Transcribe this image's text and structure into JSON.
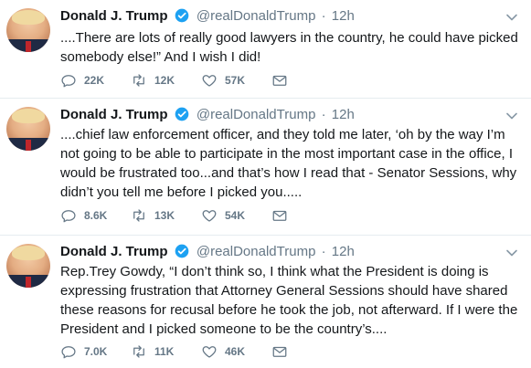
{
  "tweets": [
    {
      "name": "Donald J. Trump",
      "handle": "@realDonaldTrump",
      "separator": "·",
      "time": "12h",
      "text": "....There are lots of really good lawyers in the country, he could have picked somebody else!” And I wish I did!",
      "replies": "22K",
      "retweets": "12K",
      "likes": "57K"
    },
    {
      "name": "Donald J. Trump",
      "handle": "@realDonaldTrump",
      "separator": "·",
      "time": "12h",
      "text": "....chief law enforcement officer, and they told me later, ‘oh by the way I’m not going to be able to participate in the most important case in the office, I would be frustrated too...and that’s how I read that - Senator Sessions, why didn’t you tell me before I picked you.....",
      "replies": "8.6K",
      "retweets": "13K",
      "likes": "54K"
    },
    {
      "name": "Donald J. Trump",
      "handle": "@realDonaldTrump",
      "separator": "·",
      "time": "12h",
      "text": "Rep.Trey Gowdy, “I don’t think so, I think what the President is doing is expressing frustration that Attorney General Sessions should have shared these reasons for recusal before he took the job, not afterward. If I were the President and I picked someone to be the country’s....",
      "replies": "7.0K",
      "retweets": "11K",
      "likes": "46K"
    }
  ],
  "icons": {
    "verified": "verified-badge-icon",
    "caret": "chevron-down-icon",
    "reply": "reply-icon",
    "retweet": "retweet-icon",
    "like": "heart-icon",
    "message": "envelope-icon"
  },
  "colors": {
    "text": "#14171a",
    "muted": "#657786",
    "verified": "#1da1f2",
    "divider": "#e6ecf0"
  }
}
